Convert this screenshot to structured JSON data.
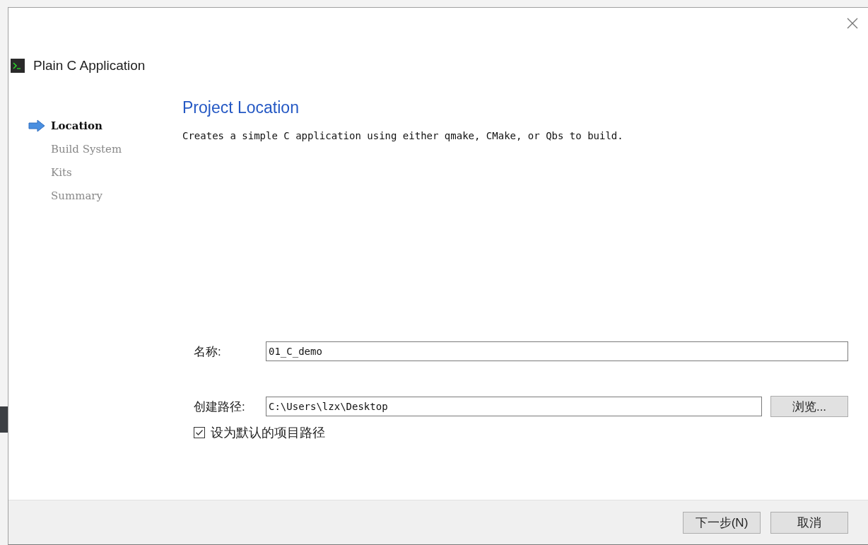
{
  "window": {
    "title": "Plain C Application"
  },
  "steps": [
    {
      "label": "Location",
      "selected": true
    },
    {
      "label": "Build System",
      "selected": false
    },
    {
      "label": "Kits",
      "selected": false
    },
    {
      "label": "Summary",
      "selected": false
    }
  ],
  "page": {
    "title": "Project Location",
    "description": "Creates a simple C application using either qmake, CMake, or Qbs to build."
  },
  "name_field": {
    "label": "名称:",
    "value": "01_C_demo"
  },
  "path_field": {
    "label": "创建路径:",
    "value": "C:\\Users\\lzx\\Desktop",
    "button": "浏览..."
  },
  "default_path": {
    "label": "设为默认的项目路径",
    "checked": true
  },
  "buttons": [
    "下一步(N)",
    "取消"
  ]
}
